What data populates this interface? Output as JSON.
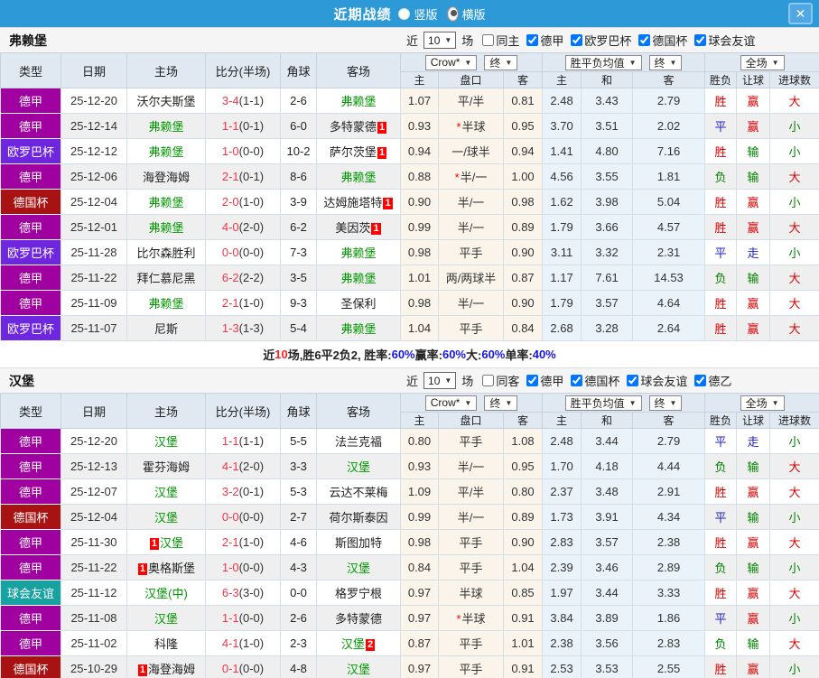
{
  "titlebar": {
    "title": "近期战绩",
    "close_glyph": "✕",
    "radios": [
      {
        "label": "竖版",
        "name": "radio-vertical-layout",
        "selected": false
      },
      {
        "label": "横版",
        "name": "radio-horizontal-layout",
        "selected": true
      }
    ]
  },
  "icons": {
    "dropdown": "▼",
    "star": "*"
  },
  "table_header": {
    "main_cols": [
      "类型",
      "日期",
      "主场",
      "比分(半场)",
      "角球",
      "客场"
    ],
    "sub_cols": [
      "主",
      "盘口",
      "客",
      "主",
      "和",
      "客",
      "胜负",
      "让球",
      "进球数"
    ],
    "selects": [
      {
        "label": "Crow*",
        "name": "bookmaker-select"
      },
      {
        "label": "终",
        "name": "handicap-time-select"
      },
      {
        "label": "胜平负均值",
        "name": "odds-average-select"
      },
      {
        "label": "终",
        "name": "odds-time-select"
      },
      {
        "label": "全场",
        "name": "match-scope-select"
      }
    ],
    "select_groups": [
      [
        0,
        1
      ],
      [
        2,
        3
      ],
      [
        4
      ]
    ]
  },
  "league_colors": {
    "德甲": "#A100A1",
    "欧罗巴杯": "#6E26DF",
    "德国杯": "#A81212",
    "球会友谊": "#17A2A2"
  },
  "result_colors": {
    "胜": "#DD0000",
    "平": "#2222CC",
    "负": "#008000",
    "赢": "#DD0000",
    "走": "#2222CC",
    "输": "#008000",
    "大": "#DD0000",
    "小": "#008000"
  },
  "sections": [
    {
      "team": "弗赖堡",
      "filters": {
        "prefix": "近",
        "count": "10",
        "suffix": "场",
        "same": {
          "label": "同主",
          "checked": false
        },
        "leagues": [
          {
            "label": "德甲",
            "checked": true
          },
          {
            "label": "欧罗巴杯",
            "checked": true
          },
          {
            "label": "德国杯",
            "checked": true
          },
          {
            "label": "球会友谊",
            "checked": true
          }
        ]
      },
      "rows": [
        {
          "lg": "德甲",
          "date": "25-12-20",
          "home": {
            "n": "沃尔夫斯堡"
          },
          "ft": "3-4",
          "ht": "(1-1)",
          "cn": "2-6",
          "away": {
            "n": "弗赖堡",
            "g": true
          },
          "h1": "1.07",
          "line": "平/半",
          "star": false,
          "h2": "0.81",
          "o1": "2.48",
          "o2": "3.43",
          "o3": "2.79",
          "r1": "胜",
          "r2": "赢",
          "r3": "大"
        },
        {
          "lg": "德甲",
          "date": "25-12-14",
          "home": {
            "n": "弗赖堡",
            "g": true
          },
          "ft": "1-1",
          "ht": "(0-1)",
          "cn": "6-0",
          "away": {
            "n": "多特蒙德",
            "b": "1",
            "bp": "after"
          },
          "h1": "0.93",
          "line": "半球",
          "star": true,
          "h2": "0.95",
          "o1": "3.70",
          "o2": "3.51",
          "o3": "2.02",
          "r1": "平",
          "r2": "赢",
          "r3": "小"
        },
        {
          "lg": "欧罗巴杯",
          "date": "25-12-12",
          "home": {
            "n": "弗赖堡",
            "g": true
          },
          "ft": "1-0",
          "ht": "(0-0)",
          "cn": "10-2",
          "away": {
            "n": "萨尔茨堡",
            "b": "1",
            "bp": "after"
          },
          "h1": "0.94",
          "line": "一/球半",
          "star": false,
          "h2": "0.94",
          "o1": "1.41",
          "o2": "4.80",
          "o3": "7.16",
          "r1": "胜",
          "r2": "输",
          "r3": "小"
        },
        {
          "lg": "德甲",
          "date": "25-12-06",
          "home": {
            "n": "海登海姆"
          },
          "ft": "2-1",
          "ht": "(0-1)",
          "cn": "8-6",
          "away": {
            "n": "弗赖堡",
            "g": true
          },
          "h1": "0.88",
          "line": "半/一",
          "star": true,
          "h2": "1.00",
          "o1": "4.56",
          "o2": "3.55",
          "o3": "1.81",
          "r1": "负",
          "r2": "输",
          "r3": "大"
        },
        {
          "lg": "德国杯",
          "date": "25-12-04",
          "home": {
            "n": "弗赖堡",
            "g": true
          },
          "ft": "2-0",
          "ht": "(1-0)",
          "cn": "3-9",
          "away": {
            "n": "达姆施塔特",
            "b": "1",
            "bp": "after"
          },
          "h1": "0.90",
          "line": "半/一",
          "star": false,
          "h2": "0.98",
          "o1": "1.62",
          "o2": "3.98",
          "o3": "5.04",
          "r1": "胜",
          "r2": "赢",
          "r3": "小"
        },
        {
          "lg": "德甲",
          "date": "25-12-01",
          "home": {
            "n": "弗赖堡",
            "g": true
          },
          "ft": "4-0",
          "ht": "(2-0)",
          "cn": "6-2",
          "away": {
            "n": "美因茨",
            "b": "1",
            "bp": "after"
          },
          "h1": "0.99",
          "line": "半/一",
          "star": false,
          "h2": "0.89",
          "o1": "1.79",
          "o2": "3.66",
          "o3": "4.57",
          "r1": "胜",
          "r2": "赢",
          "r3": "大"
        },
        {
          "lg": "欧罗巴杯",
          "date": "25-11-28",
          "home": {
            "n": "比尔森胜利"
          },
          "ft": "0-0",
          "ht": "(0-0)",
          "cn": "7-3",
          "away": {
            "n": "弗赖堡",
            "g": true
          },
          "h1": "0.98",
          "line": "平手",
          "star": false,
          "h2": "0.90",
          "o1": "3.11",
          "o2": "3.32",
          "o3": "2.31",
          "r1": "平",
          "r2": "走",
          "r3": "小"
        },
        {
          "lg": "德甲",
          "date": "25-11-22",
          "home": {
            "n": "拜仁慕尼黑"
          },
          "ft": "6-2",
          "ht": "(2-2)",
          "cn": "3-5",
          "away": {
            "n": "弗赖堡",
            "g": true
          },
          "h1": "1.01",
          "line": "两/两球半",
          "star": false,
          "h2": "0.87",
          "o1": "1.17",
          "o2": "7.61",
          "o3": "14.53",
          "r1": "负",
          "r2": "输",
          "r3": "大"
        },
        {
          "lg": "德甲",
          "date": "25-11-09",
          "home": {
            "n": "弗赖堡",
            "g": true
          },
          "ft": "2-1",
          "ht": "(1-0)",
          "cn": "9-3",
          "away": {
            "n": "圣保利"
          },
          "h1": "0.98",
          "line": "半/一",
          "star": false,
          "h2": "0.90",
          "o1": "1.79",
          "o2": "3.57",
          "o3": "4.64",
          "r1": "胜",
          "r2": "赢",
          "r3": "大"
        },
        {
          "lg": "欧罗巴杯",
          "date": "25-11-07",
          "home": {
            "n": "尼斯"
          },
          "ft": "1-3",
          "ht": "(1-3)",
          "cn": "5-4",
          "away": {
            "n": "弗赖堡",
            "g": true
          },
          "h1": "1.04",
          "line": "平手",
          "star": false,
          "h2": "0.84",
          "o1": "2.68",
          "o2": "3.28",
          "o3": "2.64",
          "r1": "胜",
          "r2": "赢",
          "r3": "大"
        }
      ],
      "summary": [
        {
          "t": "近",
          "c": "k"
        },
        {
          "t": "10",
          "c": "r"
        },
        {
          "t": "场,胜6平2负2, 胜率:",
          "c": "k"
        },
        {
          "t": "60%",
          "c": "b"
        },
        {
          "t": " 赢率:",
          "c": "k"
        },
        {
          "t": "60%",
          "c": "b"
        },
        {
          "t": " 大:",
          "c": "k"
        },
        {
          "t": "60%",
          "c": "b"
        },
        {
          "t": " 单率:",
          "c": "k"
        },
        {
          "t": "40%",
          "c": "b"
        }
      ]
    },
    {
      "team": "汉堡",
      "filters": {
        "prefix": "近",
        "count": "10",
        "suffix": "场",
        "same": {
          "label": "同客",
          "checked": false
        },
        "leagues": [
          {
            "label": "德甲",
            "checked": true
          },
          {
            "label": "德国杯",
            "checked": true
          },
          {
            "label": "球会友谊",
            "checked": true
          },
          {
            "label": "德乙",
            "checked": true
          }
        ]
      },
      "rows": [
        {
          "lg": "德甲",
          "date": "25-12-20",
          "home": {
            "n": "汉堡",
            "g": true
          },
          "ft": "1-1",
          "ht": "(1-1)",
          "cn": "5-5",
          "away": {
            "n": "法兰克福"
          },
          "h1": "0.80",
          "line": "平手",
          "star": false,
          "h2": "1.08",
          "o1": "2.48",
          "o2": "3.44",
          "o3": "2.79",
          "r1": "平",
          "r2": "走",
          "r3": "小"
        },
        {
          "lg": "德甲",
          "date": "25-12-13",
          "home": {
            "n": "霍芬海姆"
          },
          "ft": "4-1",
          "ht": "(2-0)",
          "cn": "3-3",
          "away": {
            "n": "汉堡",
            "g": true
          },
          "h1": "0.93",
          "line": "半/一",
          "star": false,
          "h2": "0.95",
          "o1": "1.70",
          "o2": "4.18",
          "o3": "4.44",
          "r1": "负",
          "r2": "输",
          "r3": "大"
        },
        {
          "lg": "德甲",
          "date": "25-12-07",
          "home": {
            "n": "汉堡",
            "g": true
          },
          "ft": "3-2",
          "ht": "(0-1)",
          "cn": "5-3",
          "away": {
            "n": "云达不莱梅"
          },
          "h1": "1.09",
          "line": "平/半",
          "star": false,
          "h2": "0.80",
          "o1": "2.37",
          "o2": "3.48",
          "o3": "2.91",
          "r1": "胜",
          "r2": "赢",
          "r3": "大"
        },
        {
          "lg": "德国杯",
          "date": "25-12-04",
          "home": {
            "n": "汉堡",
            "g": true
          },
          "ft": "0-0",
          "ht": "(0-0)",
          "cn": "2-7",
          "away": {
            "n": "荷尔斯泰因"
          },
          "h1": "0.99",
          "line": "半/一",
          "star": false,
          "h2": "0.89",
          "o1": "1.73",
          "o2": "3.91",
          "o3": "4.34",
          "r1": "平",
          "r2": "输",
          "r3": "小"
        },
        {
          "lg": "德甲",
          "date": "25-11-30",
          "home": {
            "n": "汉堡",
            "g": true,
            "b": "1",
            "bp": "before"
          },
          "ft": "2-1",
          "ht": "(1-0)",
          "cn": "4-6",
          "away": {
            "n": "斯图加特"
          },
          "h1": "0.98",
          "line": "平手",
          "star": false,
          "h2": "0.90",
          "o1": "2.83",
          "o2": "3.57",
          "o3": "2.38",
          "r1": "胜",
          "r2": "赢",
          "r3": "大"
        },
        {
          "lg": "德甲",
          "date": "25-11-22",
          "home": {
            "n": "奥格斯堡",
            "b": "1",
            "bp": "before"
          },
          "ft": "1-0",
          "ht": "(0-0)",
          "cn": "4-3",
          "away": {
            "n": "汉堡",
            "g": true
          },
          "h1": "0.84",
          "line": "平手",
          "star": false,
          "h2": "1.04",
          "o1": "2.39",
          "o2": "3.46",
          "o3": "2.89",
          "r1": "负",
          "r2": "输",
          "r3": "小"
        },
        {
          "lg": "球会友谊",
          "date": "25-11-12",
          "home": {
            "n": "汉堡(中)",
            "g": true
          },
          "ft": "6-3",
          "ht": "(3-0)",
          "cn": "0-0",
          "away": {
            "n": "格罗宁根"
          },
          "h1": "0.97",
          "line": "半球",
          "star": false,
          "h2": "0.85",
          "o1": "1.97",
          "o2": "3.44",
          "o3": "3.33",
          "r1": "胜",
          "r2": "赢",
          "r3": "大"
        },
        {
          "lg": "德甲",
          "date": "25-11-08",
          "home": {
            "n": "汉堡",
            "g": true
          },
          "ft": "1-1",
          "ht": "(0-0)",
          "cn": "2-6",
          "away": {
            "n": "多特蒙德"
          },
          "h1": "0.97",
          "line": "半球",
          "star": true,
          "h2": "0.91",
          "o1": "3.84",
          "o2": "3.89",
          "o3": "1.86",
          "r1": "平",
          "r2": "赢",
          "r3": "小"
        },
        {
          "lg": "德甲",
          "date": "25-11-02",
          "home": {
            "n": "科隆"
          },
          "ft": "4-1",
          "ht": "(1-0)",
          "cn": "2-3",
          "away": {
            "n": "汉堡",
            "g": true,
            "b": "2",
            "bp": "after"
          },
          "h1": "0.87",
          "line": "平手",
          "star": false,
          "h2": "1.01",
          "o1": "2.38",
          "o2": "3.56",
          "o3": "2.83",
          "r1": "负",
          "r2": "输",
          "r3": "大"
        },
        {
          "lg": "德国杯",
          "date": "25-10-29",
          "home": {
            "n": "海登海姆",
            "b": "1",
            "bp": "before"
          },
          "ft": "0-1",
          "ht": "(0-0)",
          "cn": "4-8",
          "away": {
            "n": "汉堡",
            "g": true
          },
          "h1": "0.97",
          "line": "平手",
          "star": false,
          "h2": "0.91",
          "o1": "2.53",
          "o2": "3.53",
          "o3": "2.55",
          "r1": "胜",
          "r2": "赢",
          "r3": "小"
        }
      ],
      "summary": null
    }
  ]
}
